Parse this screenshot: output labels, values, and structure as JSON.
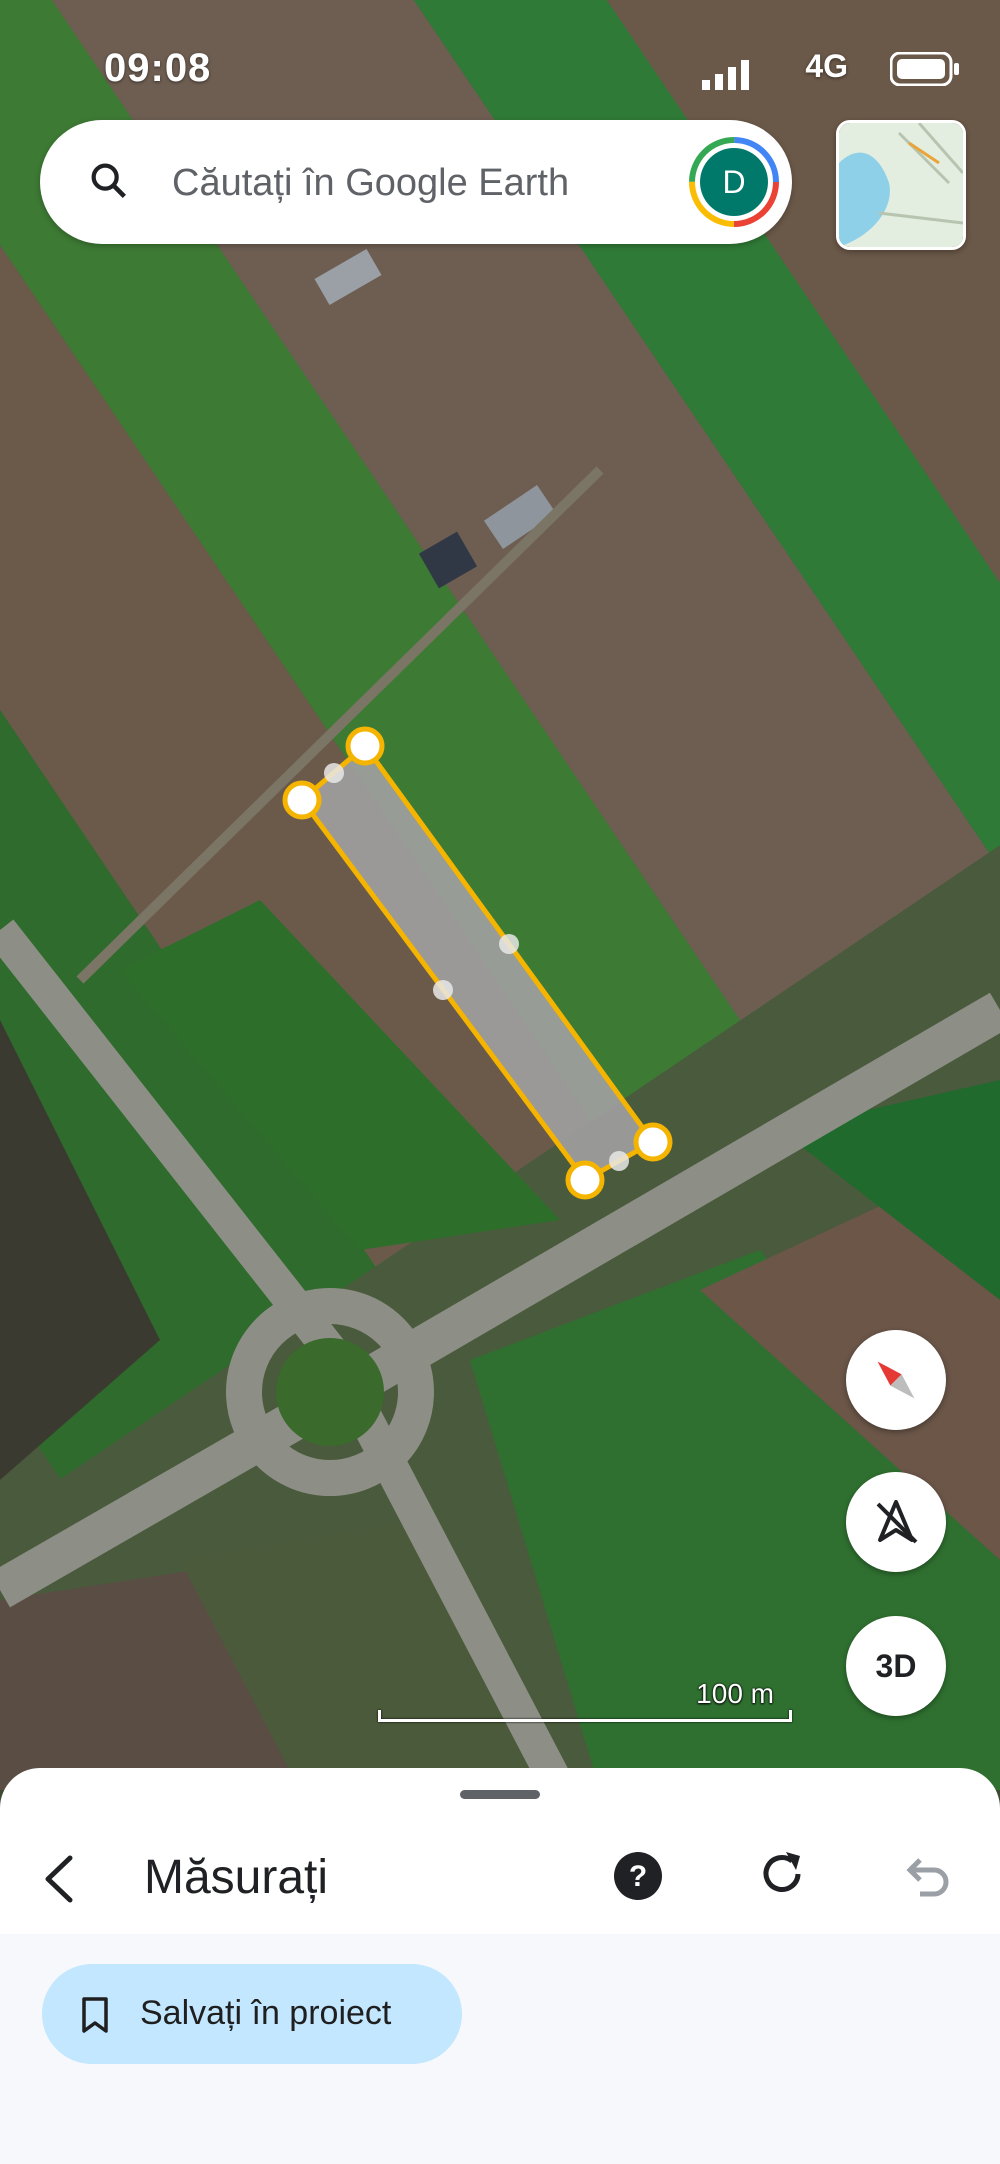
{
  "status": {
    "time": "09:08",
    "network": "4G"
  },
  "search": {
    "placeholder": "Căutați în Google Earth"
  },
  "account": {
    "initial": "D",
    "color": "#00796b"
  },
  "map": {
    "scale_label": "100 m",
    "accent_outline": "#f4b400",
    "shape_fill": "#9e9e9e",
    "buttons": [
      {
        "label": "",
        "icon": "compass-icon"
      },
      {
        "label": "",
        "icon": "nav-off-icon"
      },
      {
        "label": "3D",
        "icon": "3d-icon"
      }
    ]
  },
  "sheet": {
    "title": "Măsurați",
    "save_label": "Salvați în proiect",
    "icons": [
      "back-arrow-icon",
      "help-icon",
      "redo-icon",
      "undo-icon",
      "bookmark-icon"
    ]
  }
}
